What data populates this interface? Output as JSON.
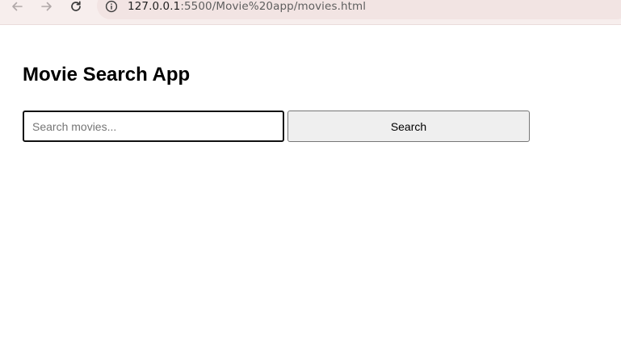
{
  "browser": {
    "url_host": "127.0.0.1",
    "url_path": ":5500/Movie%20app/movies.html",
    "icons": {
      "back": "arrow-left-icon",
      "forward": "arrow-right-icon",
      "reload": "reload-icon",
      "site_info": "info-icon"
    }
  },
  "page": {
    "title": "Movie Search App",
    "search": {
      "placeholder": "Search movies...",
      "value": "",
      "button_label": "Search"
    }
  },
  "colors": {
    "toolbar_bg": "#f7eeed",
    "omnibox_bg": "#f2e4e3",
    "button_bg": "#efefef"
  }
}
